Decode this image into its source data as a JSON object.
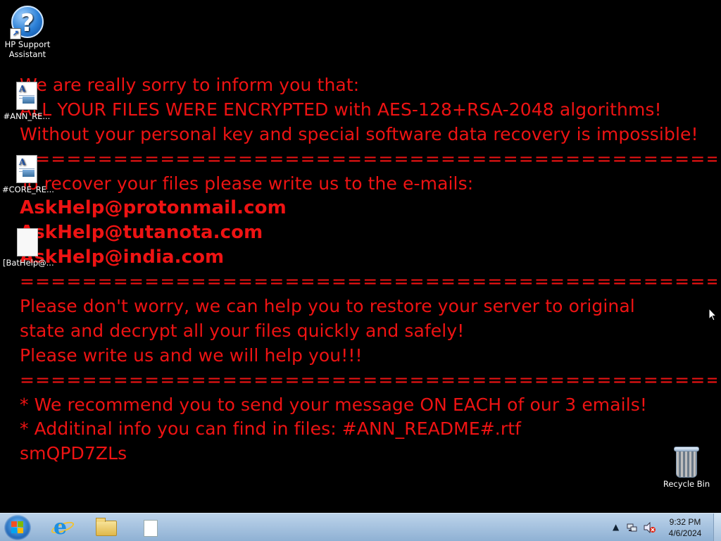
{
  "desktop": {
    "icons": [
      {
        "label": "HP Support Assistant",
        "icon": "help-question-icon"
      },
      {
        "label": "#ANN_RE...",
        "icon": "rtf-document-icon"
      },
      {
        "label": "#CORE_RE...",
        "icon": "rtf-document-icon"
      },
      {
        "label": "[BatHelp@...",
        "icon": "blank-file-icon"
      },
      {
        "label": "Recycle Bin",
        "icon": "recycle-bin-icon"
      }
    ]
  },
  "ransom_note": {
    "lines": [
      "We are really sorry to inform you that:",
      "ALL YOUR FILES WERE ENCRYPTED with AES-128+RSA-2048 algorithms!",
      "Without your personal key and special software data recovery is impossible!",
      "==================================================",
      "To recover your files please write us to the e-mails:",
      "AskHelp@protonmail.com",
      "AskHelp@tutanota.com",
      "AskHelp@india.com",
      "==================================================",
      "Please don't worry, we can help you to restore your server to original",
      "state and decrypt all your files quickly and safely!",
      "Please write us and we will help you!!!",
      "==================================================",
      "* We recommend you to send your message ON EACH of our 3 emails!",
      "* Additinal info you can find in files: #ANN_README#.rtf",
      "smQPD7ZLs"
    ],
    "color": "#ee1313"
  },
  "taskbar": {
    "pinned": [
      {
        "name": "start-button",
        "icon": "windows-flag-icon"
      },
      {
        "name": "internet-explorer",
        "icon": "internet-explorer-icon"
      },
      {
        "name": "file-explorer",
        "icon": "folder-icon"
      },
      {
        "name": "document",
        "icon": "document-icon"
      }
    ],
    "tray": {
      "icons": [
        "show-hidden-icons-arrow",
        "network-icon",
        "volume-muted-icon"
      ],
      "time": "9:32 PM",
      "date": "4/6/2024"
    }
  }
}
